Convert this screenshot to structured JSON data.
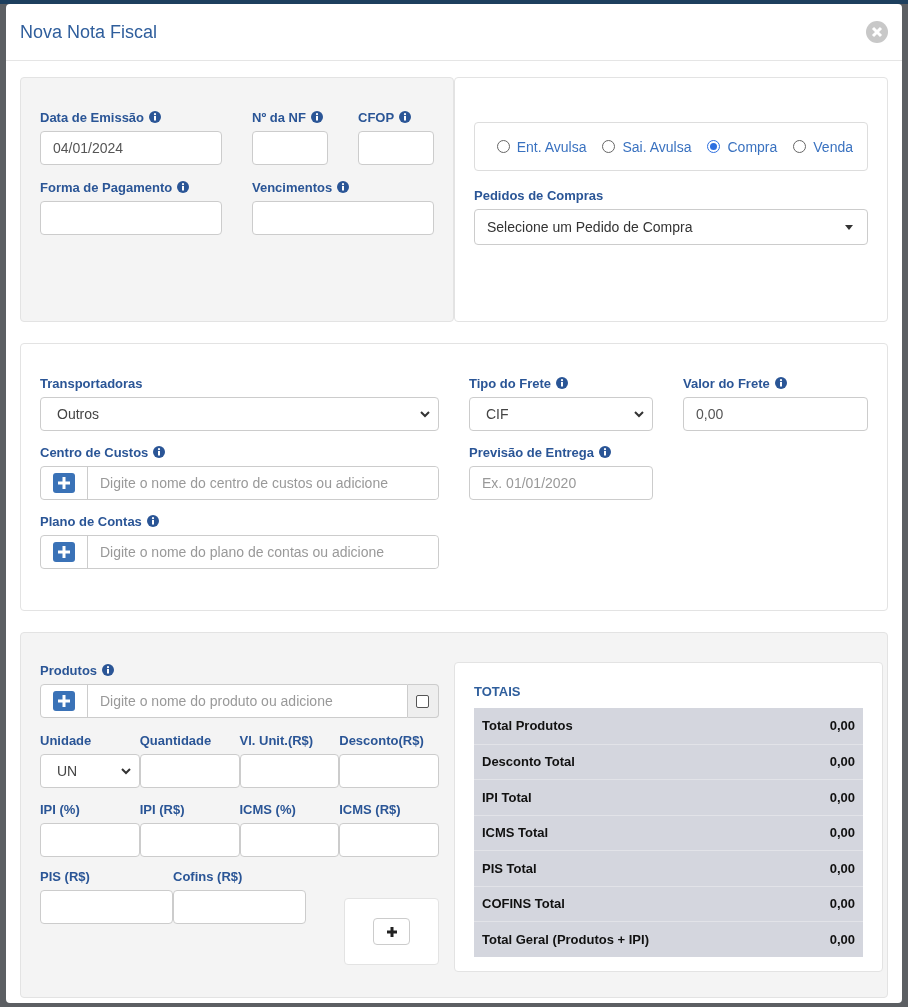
{
  "window": {
    "title": "Nova Nota Fiscal"
  },
  "emissao": {
    "fields": [
      {
        "label": "Data de Emissão",
        "info": true,
        "kind": "text",
        "value": "04/01/2024"
      },
      {
        "label": "Nº da NF",
        "info": true,
        "kind": "text"
      },
      {
        "label": "CFOP",
        "info": true,
        "kind": "text"
      },
      {
        "label": "Forma de Pagamento",
        "info": true,
        "kind": "text"
      },
      {
        "label": "Vencimentos",
        "info": true,
        "kind": "text"
      }
    ]
  },
  "operacao": {
    "options": [
      {
        "label": "Ent. Avulsa",
        "selected": false
      },
      {
        "label": "Sai. Avulsa",
        "selected": false
      },
      {
        "label": "Compra",
        "selected": true
      },
      {
        "label": "Venda",
        "selected": false
      }
    ]
  },
  "pedidos": {
    "label": "Pedidos de Compras",
    "value": "Selecione um Pedido de Compra"
  },
  "transporte": {
    "fields": [
      {
        "label": "Transportadoras",
        "info": false,
        "kind": "select",
        "value": "Outros"
      },
      {
        "label": "Tipo do Frete",
        "info": true,
        "kind": "select",
        "value": "CIF"
      },
      {
        "label": "Valor do Frete",
        "info": true,
        "kind": "text",
        "value": "0,00"
      },
      {
        "label": "Centro de Custos",
        "info": true,
        "kind": "add",
        "placeholder": "Digite o nome do centro de custos ou adicione"
      },
      {
        "label": "Previsão de Entrega",
        "info": true,
        "kind": "text",
        "placeholder": "Ex. 01/01/2020"
      },
      {
        "label": "Plano de Contas",
        "info": true,
        "kind": "add",
        "placeholder": "Digite o nome do plano de contas ou adicione"
      }
    ]
  },
  "produtos": {
    "search": {
      "label": "Produtos",
      "info": true,
      "placeholder": "Digite o nome do produto ou adicione",
      "checked": false
    },
    "fields": [
      {
        "label": "Unidade",
        "info": false,
        "kind": "select",
        "value": "UN"
      },
      {
        "label": "Quantidade",
        "info": false,
        "kind": "text"
      },
      {
        "label": "Vl. Unit.(R$)",
        "info": false,
        "kind": "text"
      },
      {
        "label": "Desconto(R$)",
        "info": false,
        "kind": "text"
      },
      {
        "label": "IPI (%)",
        "info": false,
        "kind": "text"
      },
      {
        "label": "IPI (R$)",
        "info": false,
        "kind": "text"
      },
      {
        "label": "ICMS (%)",
        "info": false,
        "kind": "text"
      },
      {
        "label": "ICMS (R$)",
        "info": false,
        "kind": "text"
      }
    ],
    "tax_fields": [
      {
        "label": "PIS (R$)",
        "info": false,
        "kind": "text"
      },
      {
        "label": "Cofins (R$)",
        "info": false,
        "kind": "text"
      }
    ]
  },
  "totais": {
    "title": "TOTAIS",
    "rows": [
      {
        "label": "Total Produtos",
        "value": "0,00"
      },
      {
        "label": "Desconto Total",
        "value": "0,00"
      },
      {
        "label": "IPI Total",
        "value": "0,00"
      },
      {
        "label": "ICMS Total",
        "value": "0,00"
      },
      {
        "label": "PIS Total",
        "value": "0,00"
      },
      {
        "label": "COFINS Total",
        "value": "0,00"
      },
      {
        "label": "Total Geral (Produtos + IPI)",
        "value": "0,00"
      }
    ]
  }
}
